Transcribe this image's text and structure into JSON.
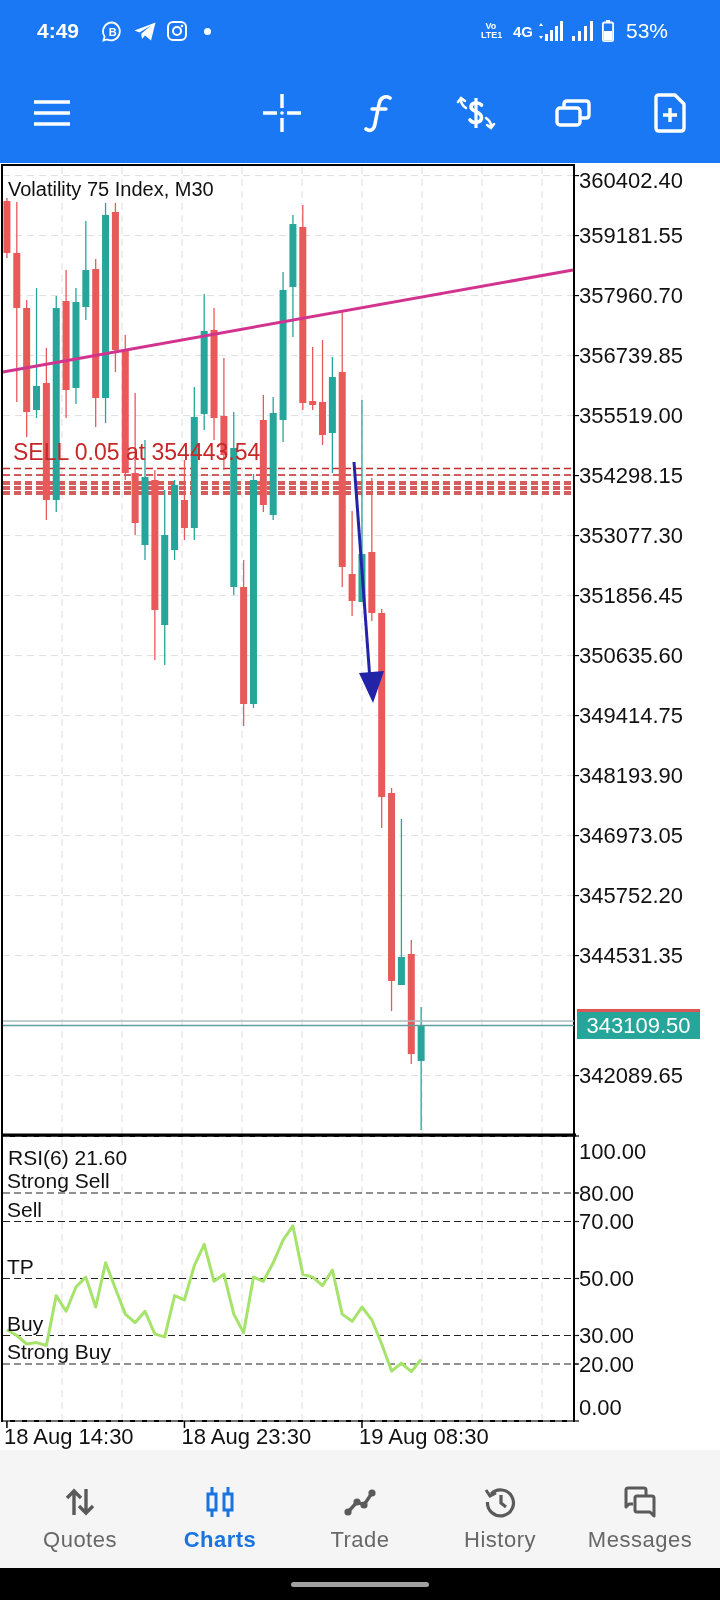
{
  "status_bar": {
    "time": "4:49",
    "app_badge": "B",
    "volte": "Vo LTE1",
    "network": "4G",
    "battery": "53%"
  },
  "chart": {
    "chart_data": {
      "type": "candlestick",
      "title": "Volatility 75 Index, M30",
      "ohlc": [
        [
          359886,
          359946,
          358726,
          358828
        ],
        [
          358828,
          359865,
          355796,
          357708
        ],
        [
          357708,
          357871,
          355084,
          355592
        ],
        [
          355633,
          358115,
          355470,
          356121
        ],
        [
          356182,
          356894,
          353395,
          353802
        ],
        [
          353802,
          357952,
          353558,
          357708
        ],
        [
          357851,
          358482,
          355470,
          356040
        ],
        [
          356081,
          358115,
          355755,
          357830
        ],
        [
          357729,
          359479,
          357464,
          358482
        ],
        [
          358502,
          358705,
          355287,
          355877
        ],
        [
          355877,
          359845,
          355368,
          359601
        ],
        [
          359662,
          359845,
          356406,
          356854
        ],
        [
          356854,
          357159,
          354209,
          354351
        ],
        [
          354351,
          355979,
          353090,
          353334
        ],
        [
          352886,
          355023,
          352581,
          354270
        ],
        [
          354209,
          354412,
          350546,
          351564
        ],
        [
          351258,
          354005,
          350444,
          353090
        ],
        [
          352784,
          354209,
          352581,
          354107
        ],
        [
          353802,
          354616,
          352988,
          353232
        ],
        [
          353232,
          356101,
          352988,
          355491
        ],
        [
          355552,
          357993,
          355226,
          357240
        ],
        [
          357261,
          357708,
          355023,
          355470
        ],
        [
          355511,
          356691,
          354412,
          354717
        ],
        [
          352032,
          355592,
          351869,
          354860
        ],
        [
          352032,
          352581,
          349203,
          349651
        ],
        [
          349651,
          354331,
          349570,
          354209
        ],
        [
          355430,
          355938,
          353558,
          353700
        ],
        [
          353497,
          355897,
          353395,
          355572
        ],
        [
          355430,
          358441,
          354982,
          358075
        ],
        [
          358136,
          359601,
          357118,
          359417
        ],
        [
          359356,
          359804,
          355633,
          355775
        ],
        [
          355816,
          356915,
          355633,
          355735
        ],
        [
          355796,
          357057,
          354921,
          355124
        ],
        [
          355165,
          356711,
          354351,
          356304
        ],
        [
          356406,
          357668,
          352032,
          352439
        ],
        [
          352296,
          353578,
          351441,
          351747
        ],
        [
          351726,
          355836,
          351726,
          352703
        ],
        [
          352744,
          354249,
          351340,
          351503
        ],
        [
          351503,
          351584,
          347128,
          347759
        ],
        [
          347840,
          347942,
          343404,
          344015
        ],
        [
          343933,
          347311,
          343933,
          344503
        ],
        [
          344564,
          344849,
          342326,
          342529
        ],
        [
          342387,
          343486,
          340983,
          343109.5
        ],
        null,
        null,
        null,
        null,
        null,
        null,
        null,
        null,
        null,
        null,
        null,
        null,
        null,
        null,
        null
      ],
      "ylim": [
        340881,
        360618
      ],
      "yticks": [
        {
          "value": 360402.4,
          "label": "360402.40"
        },
        {
          "value": 359181.55,
          "label": "359181.55"
        },
        {
          "value": 357960.7,
          "label": "357960.70"
        },
        {
          "value": 356739.85,
          "label": "356739.85"
        },
        {
          "value": 355519,
          "label": "355519.00"
        },
        {
          "value": 354298.15,
          "label": "354298.15"
        },
        {
          "value": 353077.3,
          "label": "353077.30"
        },
        {
          "value": 351856.45,
          "label": "351856.45"
        },
        {
          "value": 350635.6,
          "label": "350635.60"
        },
        {
          "value": 349414.75,
          "label": "349414.75"
        },
        {
          "value": 348193.9,
          "label": "348193.90"
        },
        {
          "value": 346973.05,
          "label": "346973.05"
        },
        {
          "value": 345752.2,
          "label": "345752.20"
        },
        {
          "value": 344531.35,
          "label": "344531.35"
        },
        {
          "value": 342089.65,
          "label": "342089.65"
        }
      ],
      "grid": true,
      "ref_lines": [
        {
          "axis": "y",
          "value": 354443.54,
          "label": "SELL 0.05 at 354443.54",
          "color": "#c62828"
        },
        {
          "axis": "y",
          "value": 354310,
          "color": "#c62828"
        },
        {
          "axis": "y",
          "value": 354168,
          "color": "#c62828"
        },
        {
          "axis": "y",
          "value": 354127,
          "color": "#c62828"
        },
        {
          "axis": "y",
          "value": 354066,
          "color": "#c62828"
        },
        {
          "axis": "y",
          "value": 354026,
          "color": "#c62828"
        },
        {
          "axis": "y",
          "value": 353965,
          "color": "#c62828"
        },
        {
          "axis": "y",
          "value": 353924,
          "color": "#c62828"
        }
      ],
      "annotations": [
        "343109.50"
      ]
    }
  },
  "rsi": {
    "chart_data": {
      "type": "line",
      "title": "RSI(6) 21.60",
      "series": [
        {
          "color": "#a6e36b",
          "values": [
            32,
            30,
            27,
            27.5,
            26.5,
            44,
            38.5,
            47,
            50.5,
            40,
            55.5,
            46.5,
            37.5,
            34.5,
            38.5,
            30.5,
            29.5,
            44,
            42.5,
            54.5,
            62,
            49,
            51.5,
            37.5,
            31,
            50.5,
            49,
            55.5,
            63.5,
            68.5,
            51.5,
            50.5,
            47.5,
            53,
            37.5,
            35,
            40,
            35.5,
            27,
            17.5,
            20.3,
            17.3,
            21.6,
            null,
            null,
            null,
            null,
            null,
            null,
            null,
            null,
            null,
            null,
            null,
            null,
            null,
            null,
            null
          ]
        }
      ],
      "ylim": [
        0,
        100
      ],
      "yticks": [
        {
          "value": 100,
          "label": "100.00"
        },
        {
          "value": 80,
          "label": "80.00"
        },
        {
          "value": 70,
          "label": "70.00"
        },
        {
          "value": 50,
          "label": "50.00"
        },
        {
          "value": 30,
          "label": "30.00"
        },
        {
          "value": 20,
          "label": "20.00"
        },
        {
          "value": 0,
          "label": "0.00"
        }
      ],
      "grid": true,
      "ref_lines": [
        {
          "axis": "y",
          "value": 80,
          "label": "Strong Sell"
        },
        {
          "axis": "y",
          "value": 70,
          "label": "Sell"
        },
        {
          "axis": "y",
          "value": 50,
          "label": "TP"
        },
        {
          "axis": "y",
          "value": 30,
          "label": "Buy"
        },
        {
          "axis": "y",
          "value": 20,
          "label": "Strong Buy"
        }
      ]
    }
  },
  "time_axis": [
    "18 Aug 14:30",
    "18 Aug 23:30",
    "19 Aug 08:30"
  ],
  "nav": [
    {
      "label": "Quotes",
      "selected": false
    },
    {
      "label": "Charts",
      "selected": true
    },
    {
      "label": "Trade",
      "selected": false
    },
    {
      "label": "History",
      "selected": false
    },
    {
      "label": "Messages",
      "selected": false
    }
  ]
}
